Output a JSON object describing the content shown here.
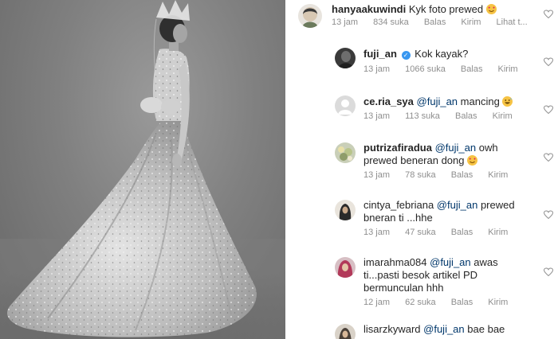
{
  "comments": [
    {
      "username": "hanyaakuwindi",
      "text": "Kyk foto prewed",
      "emoji": "heart-eyes",
      "time": "13 jam",
      "likes": "834 suka",
      "reply": "Balas",
      "send": "Kirim",
      "more": "Lihat t..."
    },
    {
      "username": "fuji_an",
      "verified": true,
      "text": "Kok kayak?",
      "time": "13 jam",
      "likes": "1066 suka",
      "reply": "Balas",
      "send": "Kirim"
    },
    {
      "username": "ce.ria_sya",
      "mention": "@fuji_an",
      "text": "mancing",
      "emoji": "grinning-sweat",
      "time": "13 jam",
      "likes": "113 suka",
      "reply": "Balas",
      "send": "Kirim"
    },
    {
      "username": "putrizafiradua",
      "mention": "@fuji_an",
      "text_line1": "owh",
      "text_line2": "prewed beneran dong",
      "emoji": "heart-eyes",
      "time": "13 jam",
      "likes": "78 suka",
      "reply": "Balas",
      "send": "Kirim"
    },
    {
      "username": "cintya_febriana",
      "mention": "@fuji_an",
      "text_line1": "prewed",
      "text_line2": "bneran ti ...hhe",
      "time": "13 jam",
      "likes": "47 suka",
      "reply": "Balas",
      "send": "Kirim"
    },
    {
      "username": "imarahma084",
      "mention": "@fuji_an",
      "text_line1": "awas",
      "text_line2": "ti...pasti besok artikel PD",
      "text_line3": "bermunculan hhh",
      "time": "12 jam",
      "likes": "62 suka",
      "reply": "Balas",
      "send": "Kirim"
    },
    {
      "username": "lisarzkyward",
      "mention": "@fuji_an",
      "text": "bae bae"
    }
  ],
  "icons": {
    "like": "heart-outline-icon"
  },
  "colors": {
    "link": "#00376b",
    "meta": "#8e8e8e",
    "verified": "#3897f0"
  }
}
